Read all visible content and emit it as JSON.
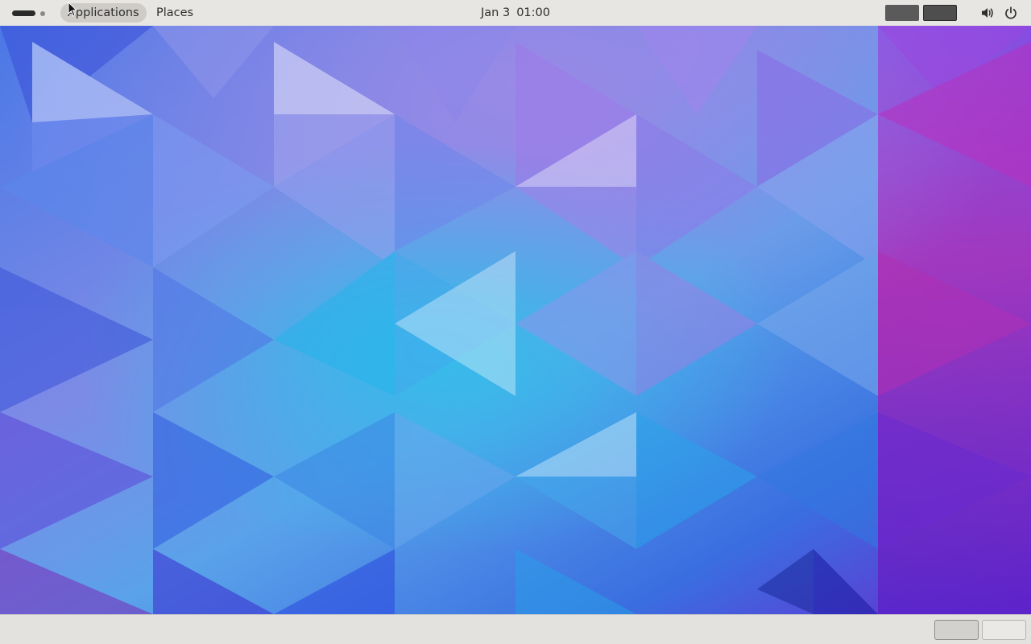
{
  "top_bar": {
    "applications_label": "Applications",
    "places_label": "Places",
    "clock_date": "Jan 3",
    "clock_time": "01:00",
    "icons": [
      "volume-icon",
      "power-icon"
    ]
  },
  "bottom_bar": {
    "workspaces": [
      "workspace-1",
      "workspace-2"
    ]
  },
  "colors": {
    "panel_bg": "#e8e6e3",
    "panel_text": "#2e2e2e",
    "wallpaper_blue": "#2f6ee8",
    "wallpaper_cyan": "#29b6ea",
    "wallpaper_violet": "#8a5ce6",
    "wallpaper_magenta": "#b02ab8"
  }
}
